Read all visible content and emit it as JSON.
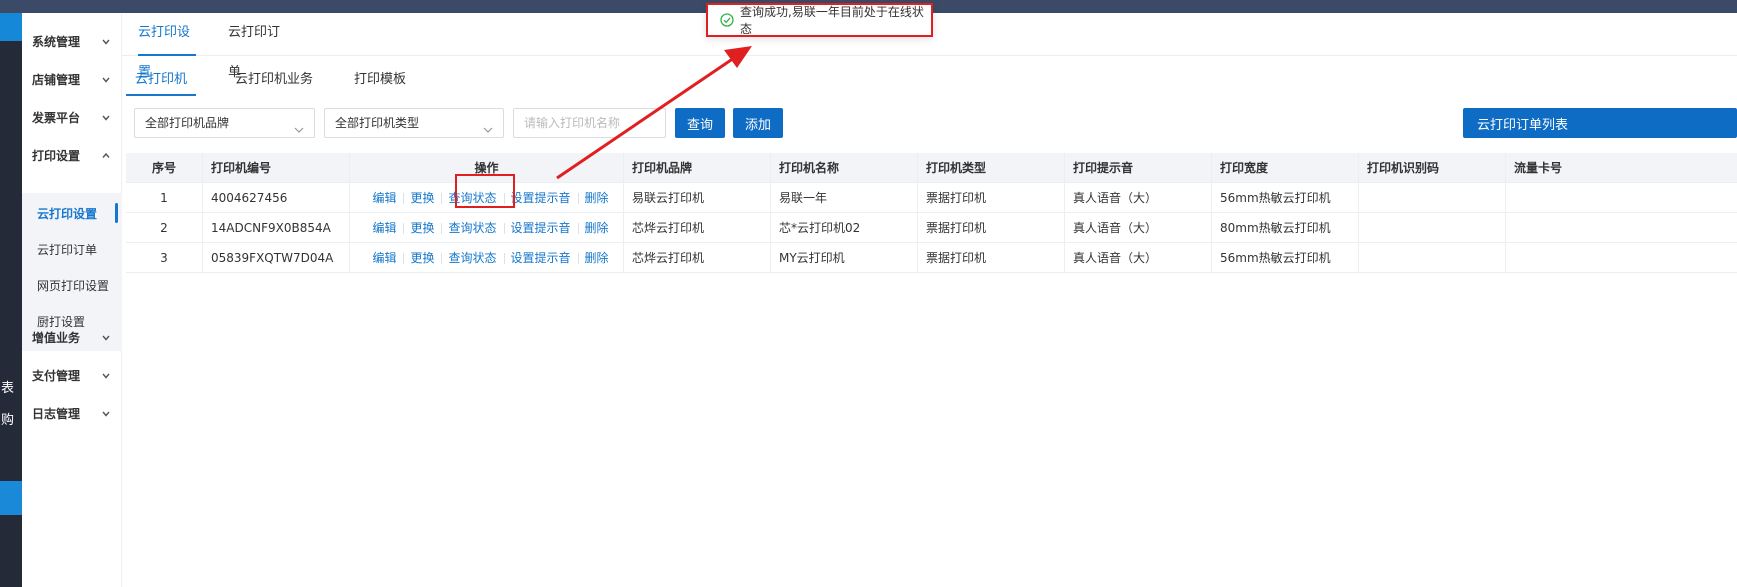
{
  "colors": {
    "accent": "#1677cc",
    "button": "#0f6cc4",
    "annotation": "#e02020",
    "success": "#2fb344"
  },
  "darknav": {
    "text1": "表",
    "text2": "购"
  },
  "sidebar": {
    "items": [
      {
        "label": "系统管理",
        "icon": "chevron-down-icon"
      },
      {
        "label": "店铺管理",
        "icon": "chevron-down-icon"
      },
      {
        "label": "发票平台",
        "icon": "chevron-down-icon"
      },
      {
        "label": "打印设置",
        "icon": "chevron-up-icon"
      },
      {
        "label": "增值业务",
        "icon": "chevron-down-icon"
      },
      {
        "label": "支付管理",
        "icon": "chevron-down-icon"
      },
      {
        "label": "日志管理",
        "icon": "chevron-down-icon"
      }
    ],
    "sub_items": [
      "云打印设置",
      "云打印订单",
      "网页打印设置",
      "厨打设置"
    ]
  },
  "tabs_top": [
    "云打印设置",
    "云打印订单"
  ],
  "tabs_sub": [
    "云打印机",
    "云打印机业务",
    "打印模板"
  ],
  "filters": {
    "brand": "全部打印机品牌",
    "type": "全部打印机类型",
    "name_placeholder": "请输入打印机名称",
    "query": "查询",
    "add": "添加",
    "order_list": "云打印订单列表"
  },
  "table": {
    "headers": [
      "序号",
      "打印机编号",
      "操作",
      "打印机品牌",
      "打印机名称",
      "打印机类型",
      "打印提示音",
      "打印宽度",
      "打印机识别码",
      "流量卡号"
    ],
    "ops": [
      "编辑",
      "更换",
      "查询状态",
      "设置提示音",
      "删除"
    ],
    "rows": [
      {
        "no": "1",
        "code": "4004627456",
        "brand": "易联云打印机",
        "name": "易联一年",
        "type": "票据打印机",
        "sound": "真人语音（大）",
        "width": "56mm热敏云打印机",
        "id": "",
        "card": ""
      },
      {
        "no": "2",
        "code": "14ADCNF9X0B854A",
        "brand": "芯烨云打印机",
        "name": "芯*云打印机02",
        "type": "票据打印机",
        "sound": "真人语音（大）",
        "width": "80mm热敏云打印机",
        "id": "",
        "card": ""
      },
      {
        "no": "3",
        "code": "05839FXQTW7D04A",
        "brand": "芯烨云打印机",
        "name": "MY云打印机",
        "type": "票据打印机",
        "sound": "真人语音（大）",
        "width": "56mm热敏云打印机",
        "id": "",
        "card": ""
      }
    ]
  },
  "toast": {
    "message": "查询成功,易联一年目前处于在线状态",
    "icon": "check-circle-icon"
  }
}
